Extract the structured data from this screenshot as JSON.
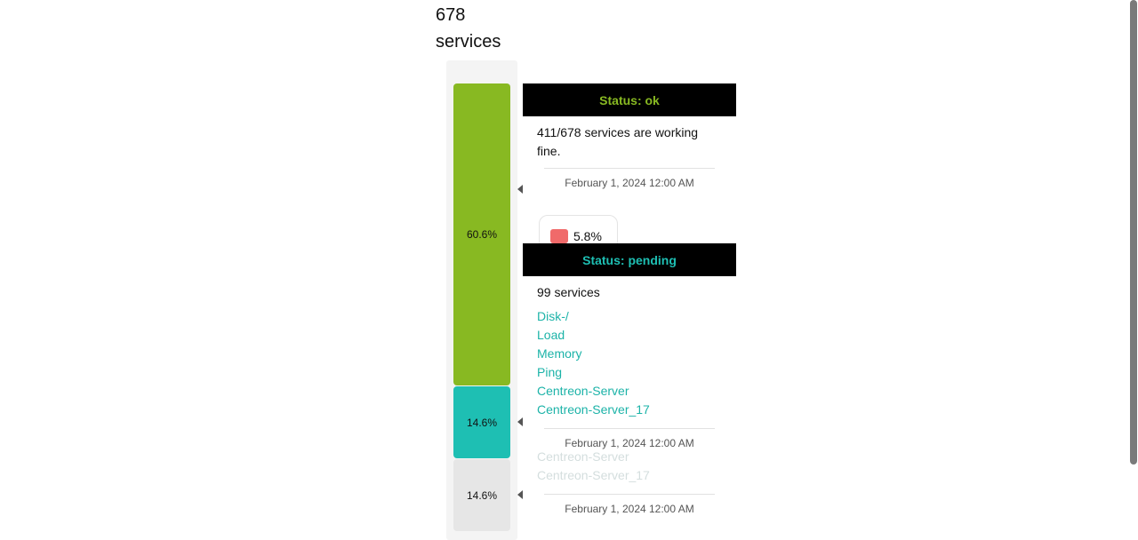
{
  "header": {
    "count": "678",
    "unit": "services"
  },
  "bar": {
    "segments": [
      {
        "status": "ok",
        "label": "60.6%",
        "fraction": 0.606,
        "color": "#88b922"
      },
      {
        "status": "pending",
        "label": "14.6%",
        "fraction": 0.146,
        "color": "#1ebfb3"
      },
      {
        "status": "unknown",
        "label": "14.6%",
        "fraction": 0.146,
        "color": "#e6e6e6"
      }
    ]
  },
  "legend": {
    "critical_value": "5.8%",
    "critical_color": "#f06a6a"
  },
  "tooltip_ok": {
    "title": "Status: ok",
    "title_color": "#88b922",
    "description": "411/678 services are working fine.",
    "date": "February 1, 2024 12:00 AM"
  },
  "tooltip_pending": {
    "title": "Status: pending",
    "title_color": "#1ebfb3",
    "summary": "99 services",
    "services": [
      "Disk-/",
      "Load",
      "Memory",
      "Ping",
      "Centreon-Server",
      "Centreon-Server_17"
    ],
    "date": "February 1, 2024 12:00 AM"
  },
  "tooltip_unknown": {
    "services": [
      "Centreon-Server",
      "Centreon-Server_17"
    ],
    "date": "February 1, 2024 12:00 AM"
  }
}
